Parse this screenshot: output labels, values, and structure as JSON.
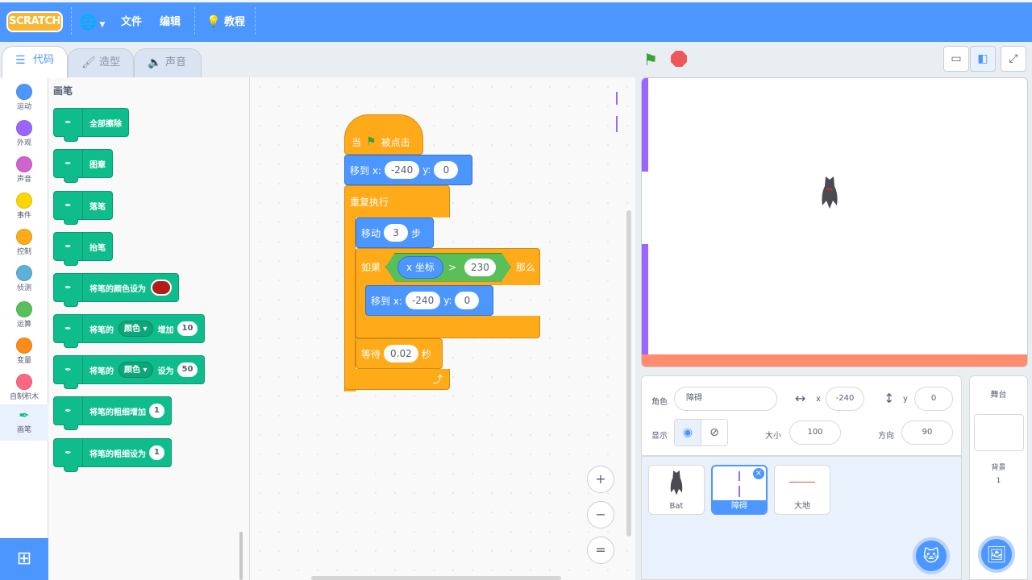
{
  "menubar": {
    "logo": "SCRATCH",
    "file": "文件",
    "edit": "编辑",
    "tutorials": "教程"
  },
  "tabs": {
    "code": "代码",
    "costumes": "造型",
    "sounds": "声音"
  },
  "categories": [
    {
      "label": "运动",
      "color": "#4c97ff"
    },
    {
      "label": "外观",
      "color": "#9966ff"
    },
    {
      "label": "声音",
      "color": "#cf63cf"
    },
    {
      "label": "事件",
      "color": "#ffd500"
    },
    {
      "label": "控制",
      "color": "#ffab19"
    },
    {
      "label": "侦测",
      "color": "#5cb1d6"
    },
    {
      "label": "运算",
      "color": "#59c059"
    },
    {
      "label": "变量",
      "color": "#ff8c1a"
    },
    {
      "label": "自制积木",
      "color": "#ff6680"
    },
    {
      "label": "画笔",
      "color": "#0fbd8c"
    }
  ],
  "palette": {
    "title": "画笔",
    "erase_all": "全部擦除",
    "stamp": "图章",
    "pen_down": "落笔",
    "pen_up": "抬笔",
    "set_color_to": "将笔的颜色设为",
    "change_prefix": "将笔的",
    "param_color": "颜色",
    "change_by": "增加",
    "change_value": "10",
    "set_prefix": "将笔的",
    "set_to": "设为",
    "set_value": "50",
    "size_change": "将笔的粗细增加",
    "size_change_value": "1",
    "size_set": "将笔的粗细设为",
    "size_set_value": "1"
  },
  "script": {
    "when_flag": "当",
    "clicked": "被点击",
    "goto1_label": "移到 x:",
    "goto1_x": "-240",
    "goto1_y_label": "y:",
    "goto1_y": "0",
    "forever": "重复执行",
    "move_label": "移动",
    "move_steps": "3",
    "move_unit": "步",
    "if_label": "如果",
    "xpos": "x 坐标",
    "gt": ">",
    "compare_value": "230",
    "then": "那么",
    "goto2_label": "移到 x:",
    "goto2_x": "-240",
    "goto2_y_label": "y:",
    "goto2_y": "0",
    "wait_label": "等待",
    "wait_value": "0.02",
    "wait_unit": "秒"
  },
  "zoom": {
    "in": "+",
    "out": "−",
    "reset": "="
  },
  "sprite_info": {
    "sprite_label": "角色",
    "sprite_name": "障碍",
    "x_label": "x",
    "x_value": "-240",
    "y_label": "y",
    "y_value": "0",
    "show_label": "显示",
    "size_label": "大小",
    "size_value": "100",
    "direction_label": "方向",
    "direction_value": "90"
  },
  "sprites": [
    {
      "name": "Bat"
    },
    {
      "name": "障碍"
    },
    {
      "name": "大地"
    }
  ],
  "stage_panel": {
    "title": "舞台",
    "backdrops_label": "背景",
    "backdrops_count": "1"
  }
}
